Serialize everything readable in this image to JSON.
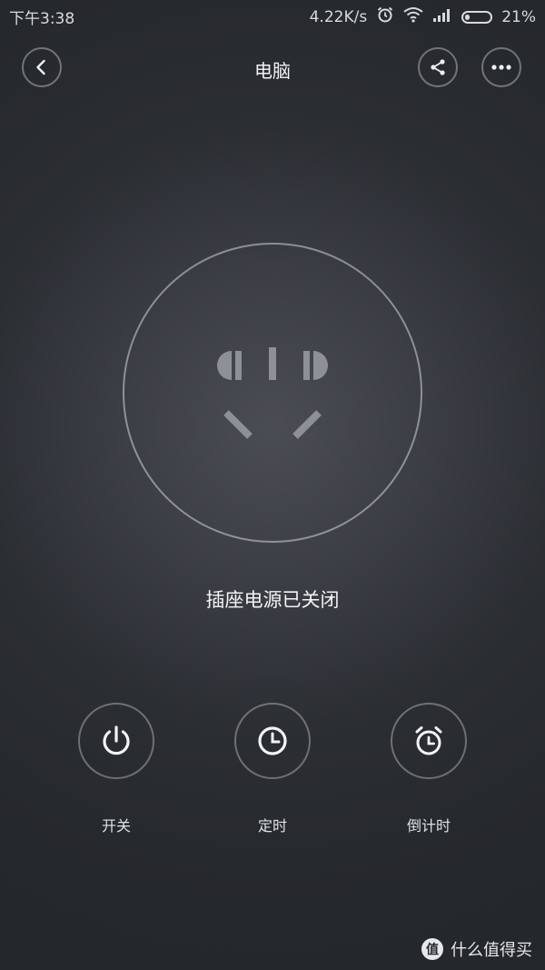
{
  "status_bar": {
    "time": "下午3:38",
    "net_speed": "4.22K/s",
    "battery": "21%",
    "battery_level": 0.21
  },
  "header": {
    "title": "电脑"
  },
  "socket": {
    "status": "插座电源已关闭"
  },
  "controls": [
    {
      "label": "开关",
      "icon": "power-icon"
    },
    {
      "label": "定时",
      "icon": "clock-icon"
    },
    {
      "label": "倒计时",
      "icon": "alarm-clock-icon"
    }
  ],
  "watermark": {
    "badge": "值",
    "text": "什么值得买"
  },
  "colors": {
    "background": "#2b2e33",
    "ring": "#a9aeb4",
    "text": "#f2f4f6"
  }
}
